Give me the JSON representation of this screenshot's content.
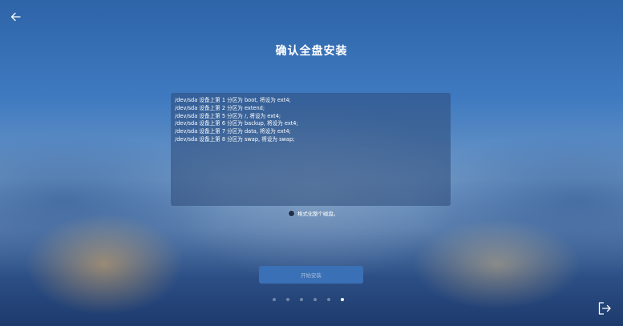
{
  "page": {
    "title": "确认全盘安装"
  },
  "install_summary": {
    "lines": [
      "/dev/sda 设备上第 1 分区为 boot, 将设为 ext4;",
      "/dev/sda 设备上第 2 分区为 extend;",
      "/dev/sda 设备上第 5 分区为 /, 将设为 ext4;",
      "/dev/sda 设备上第 6 分区为 backup, 将设为 ext4;",
      "/dev/sda 设备上第 7 分区为 data, 将设为 ext4;",
      "/dev/sda 设备上第 8 分区为 swap, 将设为 swap;"
    ]
  },
  "format_option": {
    "label": "格式化整个磁盘。",
    "checked": false
  },
  "actions": {
    "start_install_label": "开始安装"
  },
  "progress": {
    "total_steps": 6,
    "current_step": 6
  },
  "icons": {
    "back": "back-arrow-icon",
    "exit": "exit-icon"
  }
}
